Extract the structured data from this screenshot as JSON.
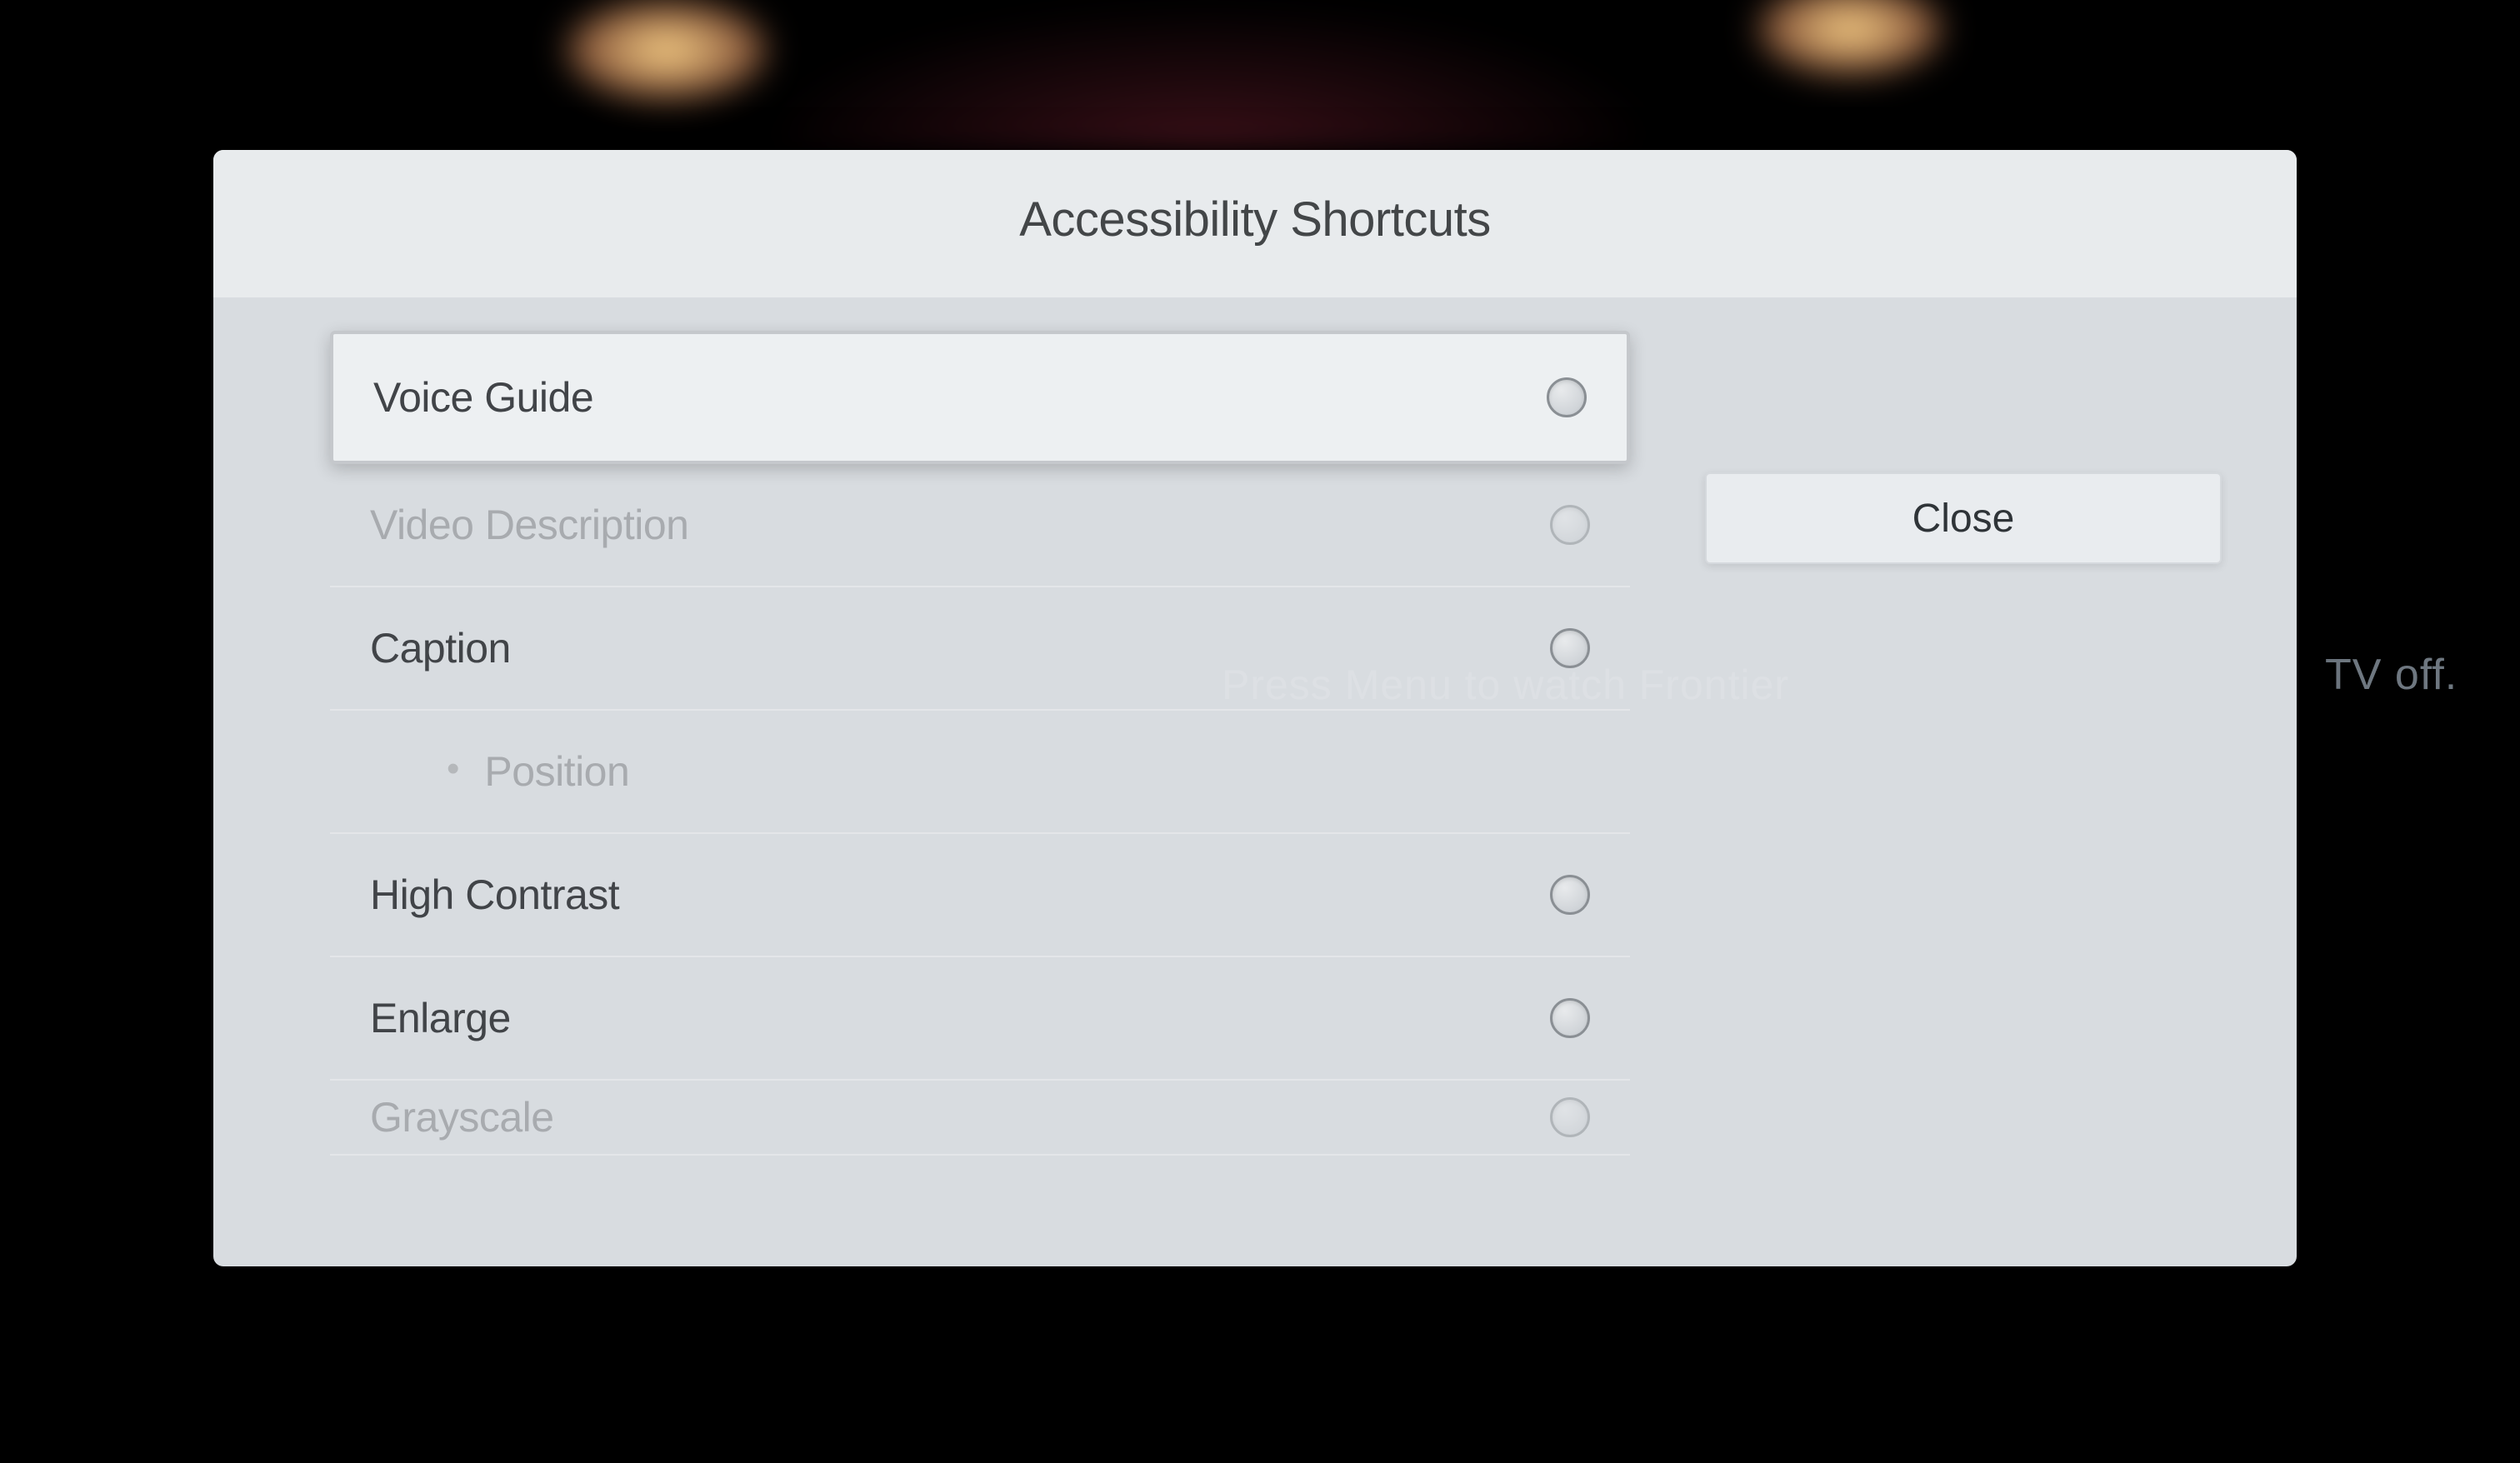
{
  "dialog": {
    "title": "Accessibility Shortcuts"
  },
  "options": {
    "voice_guide": "Voice Guide",
    "video_description": "Video Description",
    "caption": "Caption",
    "position": "Position",
    "high_contrast": "High Contrast",
    "enlarge": "Enlarge",
    "grayscale": "Grayscale"
  },
  "buttons": {
    "close": "Close"
  },
  "background": {
    "behind_text": "Press Menu to watch Frontier",
    "side_text": "TV off."
  }
}
